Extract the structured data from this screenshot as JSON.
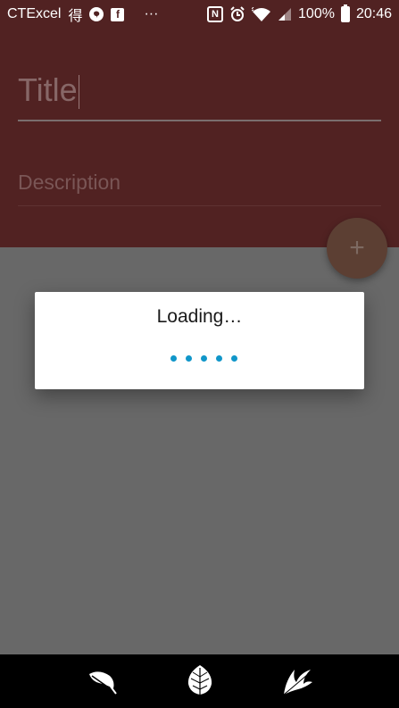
{
  "status_bar": {
    "carrier": "CTExcel",
    "char_icon": "得",
    "more": "···",
    "nfc": "N",
    "battery": "100%",
    "time": "20:46",
    "icons": [
      "chat-icon",
      "facebook-icon",
      "nfc-icon",
      "alarm-icon",
      "wifi-icon",
      "signal-icon",
      "battery-icon"
    ]
  },
  "form": {
    "title_placeholder": "Title",
    "description_placeholder": "Description"
  },
  "fab": {
    "label": "+"
  },
  "dialog": {
    "title": "Loading…",
    "dot_count": 5
  },
  "bottom_nav": {
    "items": [
      "feather-icon",
      "leaf-icon",
      "palm-leaf-icon"
    ]
  },
  "colors": {
    "header_bg": "#512222",
    "dim_bg": "#686868",
    "dot": "#1096c9",
    "fab": "#5c3f33"
  }
}
